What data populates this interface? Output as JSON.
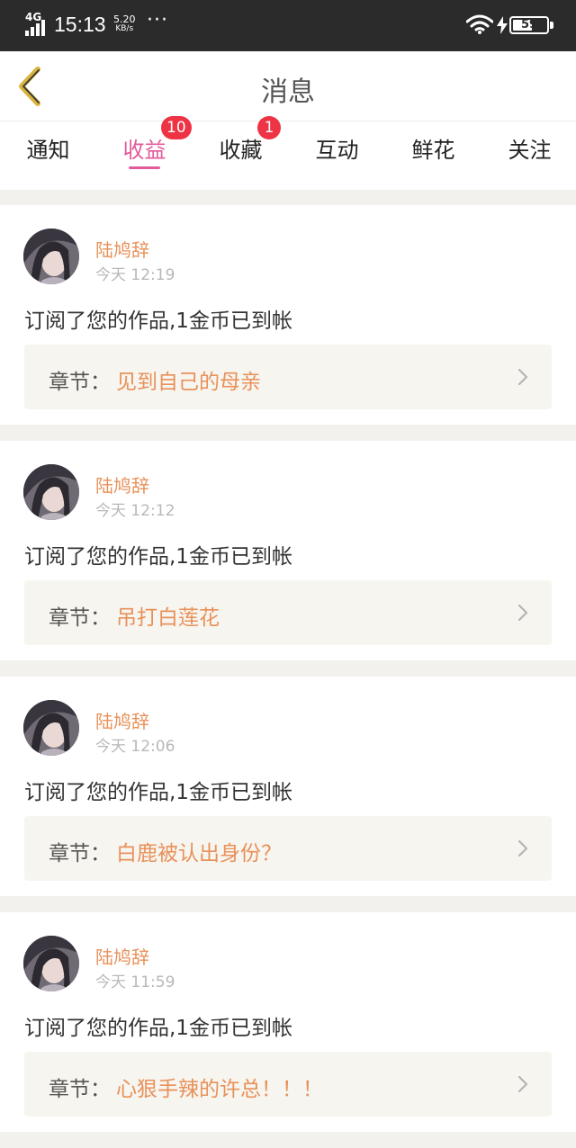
{
  "status_bar": {
    "network": "4G",
    "time": "15:13",
    "speed_value": "5.20",
    "speed_unit": "KB/s",
    "more": "···",
    "battery": "59",
    "battery_level": 0.59
  },
  "header": {
    "title": "消息"
  },
  "tabs": [
    {
      "label": "通知",
      "badge": "",
      "active": false
    },
    {
      "label": "收益",
      "badge": "10",
      "active": true
    },
    {
      "label": "收藏",
      "badge": "1",
      "active": false
    },
    {
      "label": "互动",
      "badge": "",
      "active": false
    },
    {
      "label": "鲜花",
      "badge": "",
      "active": false
    },
    {
      "label": "关注",
      "badge": "",
      "active": false
    }
  ],
  "colors": {
    "accent_pink": "#e25a9b",
    "accent_orange": "#e8915a",
    "badge_red": "#ee3344"
  },
  "messages": [
    {
      "user": "陆鸠辞",
      "time": "今天 12:19",
      "text": "订阅了您的作品,1金币已到帐",
      "chapter_prefix": "章节：",
      "chapter_title": "见到自己的母亲"
    },
    {
      "user": "陆鸠辞",
      "time": "今天 12:12",
      "text": "订阅了您的作品,1金币已到帐",
      "chapter_prefix": "章节：",
      "chapter_title": "吊打白莲花"
    },
    {
      "user": "陆鸠辞",
      "time": "今天 12:06",
      "text": "订阅了您的作品,1金币已到帐",
      "chapter_prefix": "章节：",
      "chapter_title": "白鹿被认出身份？"
    },
    {
      "user": "陆鸠辞",
      "time": "今天 11:59",
      "text": "订阅了您的作品,1金币已到帐",
      "chapter_prefix": "章节：",
      "chapter_title": "心狠手辣的许总！！！"
    }
  ]
}
